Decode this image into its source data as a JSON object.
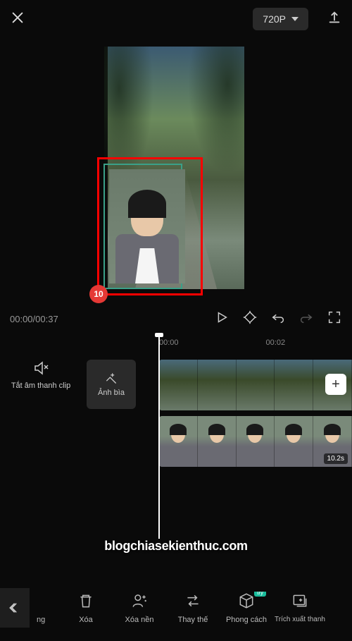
{
  "topbar": {
    "resolution": "720P"
  },
  "preview": {
    "badge_number": "10"
  },
  "controls": {
    "time_display": "00:00/00:37"
  },
  "ruler": {
    "mark1": "00:00",
    "mark2": "00:02"
  },
  "timeline": {
    "mute_label": "Tắt âm thanh clip",
    "cover_label": "Ảnh bìa",
    "clip_duration": "10.2s"
  },
  "watermark": "blogchiasekienthuc.com",
  "toolbar": {
    "item_partial": "ng",
    "delete": "Xóa",
    "remove_bg": "Xóa nền",
    "replace": "Thay thế",
    "style": "Phong cách",
    "style_badge": "try",
    "extract": "Trích xuất thanh"
  }
}
